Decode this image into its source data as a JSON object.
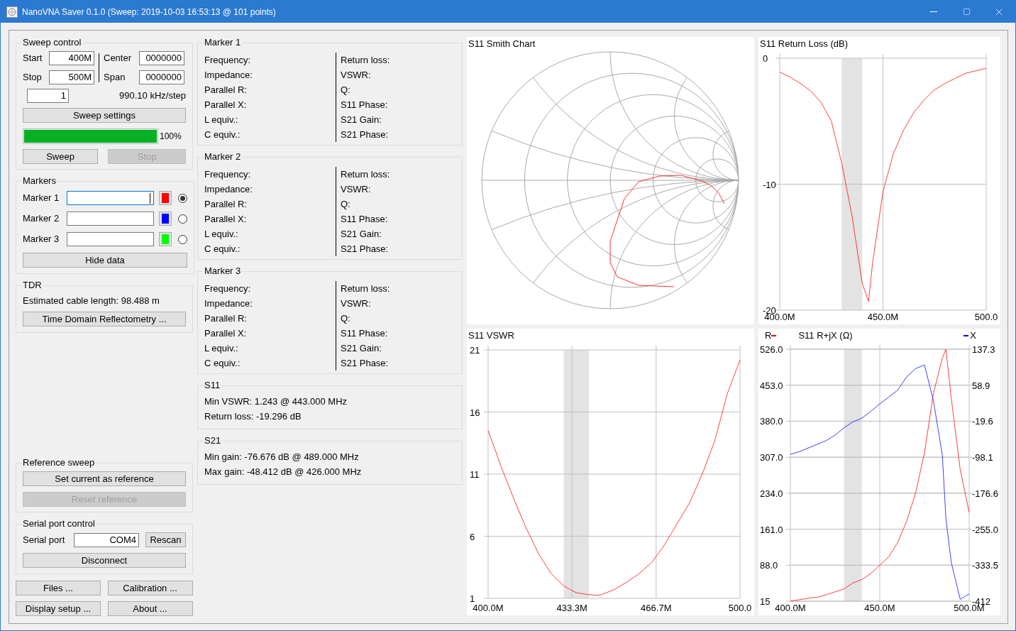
{
  "window": {
    "title": "NanoVNA Saver 0.1.0 (Sweep: 2019-10-03 16:53:13 @ 101 points)"
  },
  "sweep_control": {
    "title": "Sweep control",
    "start": {
      "label": "Start",
      "value": "400M"
    },
    "stop": {
      "label": "Stop",
      "value": "500M"
    },
    "center": {
      "label": "Center",
      "value": "0000000"
    },
    "span": {
      "label": "Span",
      "value": "0000000"
    },
    "segments": "1",
    "step": "990.10 kHz/step",
    "settings_button": {
      "label": "Sweep settings",
      "disabled": false
    },
    "progress": {
      "level": 1.0,
      "text": "100%"
    },
    "sweep_button": {
      "label": "Sweep",
      "disabled": false
    },
    "stop_button": {
      "label": "Stop",
      "disabled": true
    }
  },
  "markers": {
    "title": "Markers",
    "items": [
      {
        "label": "Marker 1",
        "color": "#ff0000",
        "selected": true,
        "focused": true
      },
      {
        "label": "Marker 2",
        "color": "#0000ff",
        "selected": false,
        "focused": false
      },
      {
        "label": "Marker 3",
        "color": "#00ff00",
        "selected": false,
        "focused": false
      }
    ],
    "hide_button": {
      "label": "Hide data",
      "disabled": false
    }
  },
  "tdr": {
    "title": "TDR",
    "text": "Estimated cable length: 98.488 m",
    "button": {
      "label": "Time Domain Reflectometry ...",
      "disabled": false
    }
  },
  "reference_sweep": {
    "title": "Reference sweep",
    "buttons": [
      {
        "label": "Set current as reference",
        "disabled": false
      },
      {
        "label": "Reset reference",
        "disabled": true
      }
    ]
  },
  "serial_port": {
    "title": "Serial port control",
    "label": "Serial port",
    "value": "COM4",
    "rescan_button": {
      "label": "Rescan",
      "disabled": false
    },
    "disconnect_button": {
      "label": "Disconnect",
      "disabled": false
    }
  },
  "bottom_buttons": [
    {
      "label": "Files ...",
      "disabled": false
    },
    {
      "label": "Calibration ...",
      "disabled": false
    },
    {
      "label": "Display setup ...",
      "disabled": false
    },
    {
      "label": "About ...",
      "disabled": false
    }
  ],
  "marker_panels": [
    {
      "title": "Marker 1",
      "left": [
        "Frequency:",
        "Impedance:",
        "Parallel R:",
        "Parallel X:",
        "L equiv.:",
        "C equiv.:"
      ],
      "right": [
        "Return loss:",
        "VSWR:",
        "Q:",
        "S11 Phase:",
        "S21 Gain:",
        "S21 Phase:"
      ]
    },
    {
      "title": "Marker 2",
      "left": [
        "Frequency:",
        "Impedance:",
        "Parallel R:",
        "Parallel X:",
        "L equiv.:",
        "C equiv.:"
      ],
      "right": [
        "Return loss:",
        "VSWR:",
        "Q:",
        "S11 Phase:",
        "S21 Gain:",
        "S21 Phase:"
      ]
    },
    {
      "title": "Marker 3",
      "left": [
        "Frequency:",
        "Impedance:",
        "Parallel R:",
        "Parallel X:",
        "L equiv.:",
        "C equiv.:"
      ],
      "right": [
        "Return loss:",
        "VSWR:",
        "Q:",
        "S11 Phase:",
        "S21 Gain:",
        "S21 Phase:"
      ]
    }
  ],
  "summaries": [
    {
      "title": "S11",
      "lines": [
        "Min VSWR: 1.243 @ 443.000 MHz",
        "Return loss: -19.296 dB"
      ]
    },
    {
      "title": "S21",
      "lines": [
        "Min gain: -76.676 dB @ 489.000 MHz",
        "Max gain: -48.412 dB @ 426.000 MHz"
      ]
    }
  ],
  "charts": [
    {
      "kind": "smith",
      "title": "S11 Smith Chart"
    },
    {
      "kind": "line",
      "title": "S11 Return Loss (dB)",
      "chart_data": {
        "type": "line",
        "x": [
          400,
          405,
          410,
          415,
          420,
          425,
          430,
          435,
          440,
          443,
          445,
          450,
          455,
          460,
          465,
          470,
          475,
          480,
          485,
          490,
          495,
          500
        ],
        "series": [
          {
            "color": "#ff0000",
            "values": [
              -1.1,
              -1.5,
              -2.0,
              -2.6,
              -3.5,
              -5.0,
              -8.3,
              -12.5,
              -17.9,
              -19.3,
              -16.2,
              -10.6,
              -7.6,
              -5.7,
              -4.3,
              -3.3,
              -2.5,
              -2.0,
              -1.6,
              -1.2,
              -1.0,
              -0.8
            ]
          }
        ],
        "xlim": [
          400,
          500
        ],
        "ylim": [
          -20,
          0
        ],
        "xticks": [
          {
            "value": 400,
            "label": "400.0M"
          },
          {
            "value": 450,
            "label": "450.0M"
          },
          {
            "value": 500,
            "label": "500.0"
          }
        ],
        "yticks": [
          {
            "value": 0,
            "label": "0"
          },
          {
            "value": -10,
            "label": "-10"
          },
          {
            "value": -20,
            "label": "-20"
          }
        ],
        "grid": true,
        "bands": [
          {
            "axis": "x",
            "from": 430,
            "to": 440
          }
        ]
      }
    },
    {
      "kind": "line",
      "title": "S11 VSWR",
      "chart_data": {
        "type": "line",
        "x": [
          400,
          405,
          410,
          415,
          420,
          425,
          430,
          435,
          440,
          443,
          445,
          450,
          455,
          460,
          465,
          470,
          475,
          480,
          485,
          490,
          495,
          500
        ],
        "series": [
          {
            "color": "#ff0000",
            "values": [
              14.5,
              11.7,
              9.1,
              6.7,
              4.6,
              3.0,
              2.0,
              1.45,
              1.3,
              1.24,
              1.3,
              1.7,
              2.3,
              3.0,
              3.9,
              5.3,
              7.0,
              8.7,
              11.0,
              13.7,
              17.5,
              20.2
            ]
          }
        ],
        "xlim": [
          400,
          500
        ],
        "ylim": [
          1,
          21
        ],
        "xticks": [
          {
            "value": 400,
            "label": "400.0M"
          },
          {
            "value": 433.3,
            "label": "433.3M"
          },
          {
            "value": 466.7,
            "label": "466.7M"
          },
          {
            "value": 500,
            "label": "500.0"
          }
        ],
        "yticks": [
          1,
          6,
          11,
          16,
          21
        ],
        "grid": true,
        "bands": [
          {
            "axis": "x",
            "from": 430,
            "to": 440
          }
        ]
      }
    },
    {
      "kind": "dual",
      "title": "S11 R+jX (Ω)",
      "chart_data": {
        "type": "line",
        "x": [
          400,
          405,
          410,
          415,
          420,
          425,
          430,
          435,
          440,
          445,
          450,
          455,
          460,
          465,
          470,
          475,
          480,
          485,
          487,
          490,
          495,
          500
        ],
        "series": [
          {
            "name": "R",
            "color": "#ff0000",
            "values": [
              15,
              18,
              21,
              23,
              28,
              34,
              40,
              52,
              59,
              71,
              88,
              105,
              134,
              177,
              234,
              316,
              436,
              508,
              526,
              426,
              282,
              195
            ]
          },
          {
            "name": "X",
            "color": "#0000ff",
            "axis": "y2",
            "values": [
              -92,
              -86,
              -78,
              -70,
              -62,
              -50,
              -34,
              -21,
              -13,
              2,
              18,
              33,
              48,
              77,
              95,
              103,
              25,
              -94,
              -233,
              -328,
              -408,
              -396
            ]
          }
        ],
        "xlim": [
          400,
          500
        ],
        "ylim": [
          15,
          526
        ],
        "y2lim": [
          -412,
          137.3
        ],
        "xticks": [
          {
            "value": 400,
            "label": "400.0M"
          },
          {
            "value": 450,
            "label": "450.0M"
          },
          {
            "value": 500,
            "label": "500.0M"
          }
        ],
        "yticks": [
          {
            "value": 526,
            "label": "526.0"
          },
          {
            "value": 453,
            "label": "453.0"
          },
          {
            "value": 380,
            "label": "380.0"
          },
          {
            "value": 307,
            "label": "307.0"
          },
          {
            "value": 234,
            "label": "234.0"
          },
          {
            "value": 161,
            "label": "161.0"
          },
          {
            "value": 88,
            "label": "88.0"
          },
          {
            "value": 15,
            "label": "15"
          }
        ],
        "y2ticks": [
          {
            "value": 137.3,
            "label": "137.3"
          },
          {
            "value": 58.9,
            "label": "58.9"
          },
          {
            "value": -19.6,
            "label": "-19.6"
          },
          {
            "value": -98.1,
            "label": "-98.1"
          },
          {
            "value": -176.6,
            "label": "-176.6"
          },
          {
            "value": -255,
            "label": "-255.0"
          },
          {
            "value": -333.5,
            "label": "-333.5"
          },
          {
            "value": -412,
            "label": "-412"
          }
        ],
        "grid": true,
        "bands": [
          {
            "axis": "x",
            "from": 430,
            "to": 440
          }
        ]
      }
    }
  ]
}
